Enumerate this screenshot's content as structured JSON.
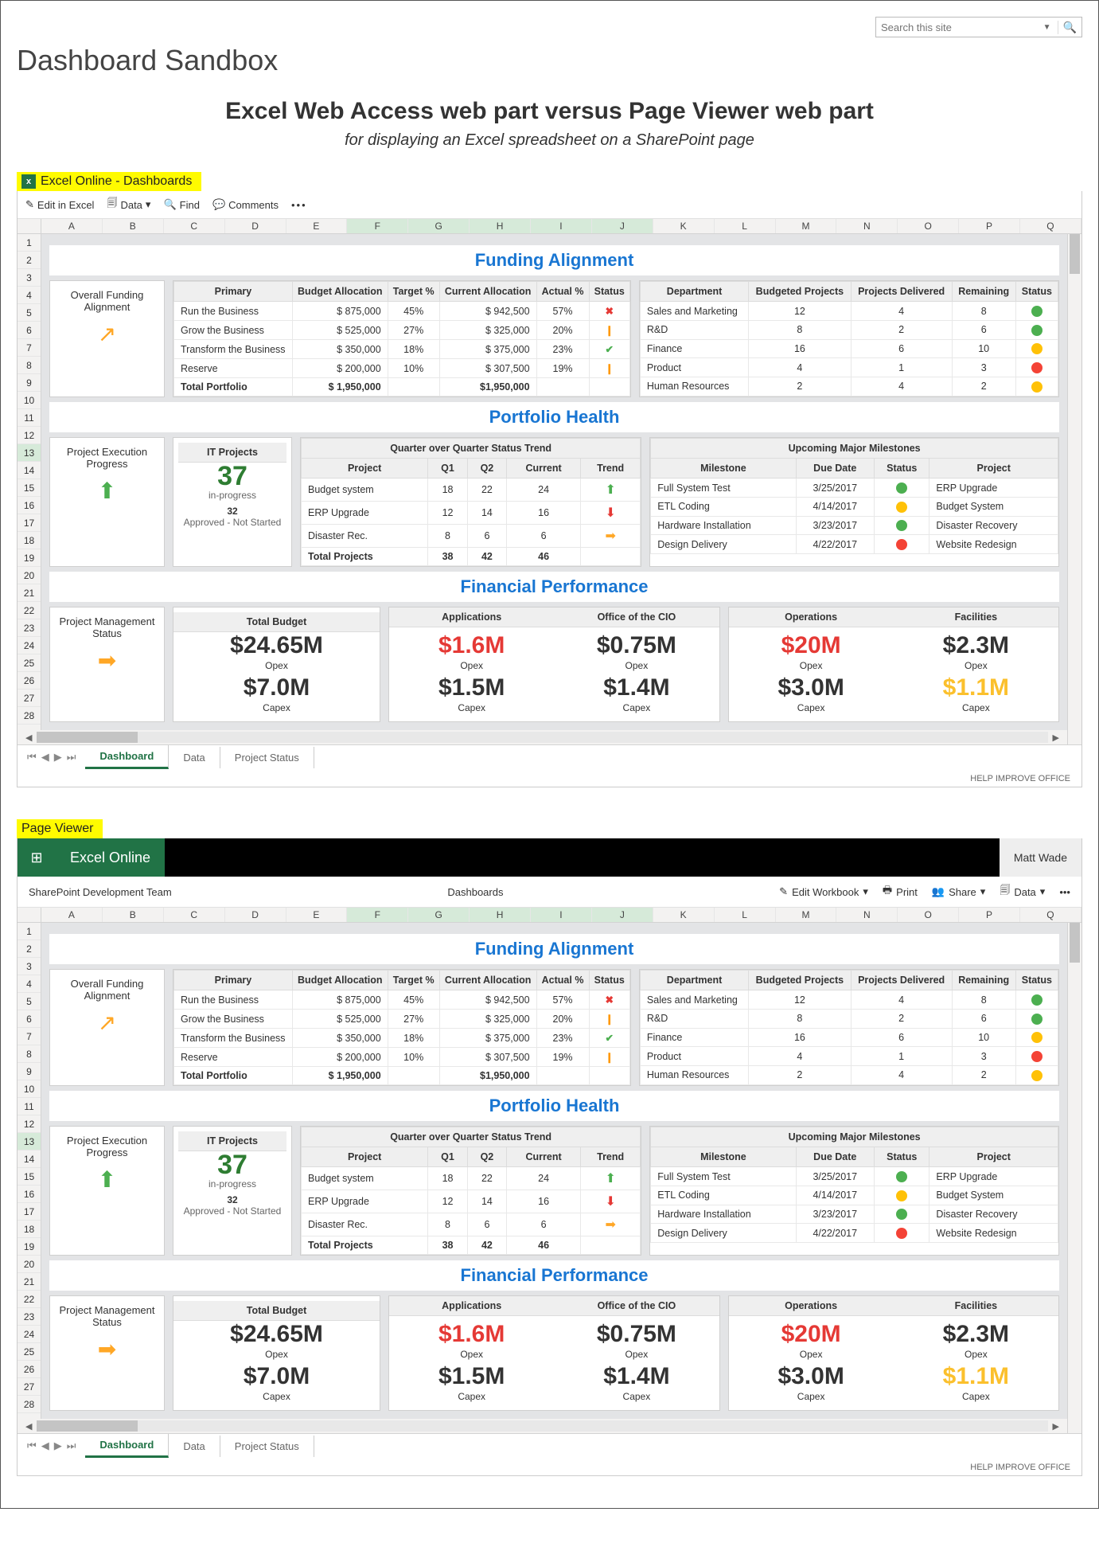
{
  "site": {
    "title": "Dashboard Sandbox",
    "search_placeholder": "Search this site"
  },
  "article": {
    "title": "Excel Web Access web part versus Page Viewer web part",
    "subtitle": "for displaying an Excel spreadsheet on a SharePoint page"
  },
  "labels": {
    "ewa": "Excel Online - Dashboards",
    "pv": "Page Viewer"
  },
  "ewa_toolbar": {
    "edit": "Edit in Excel",
    "data": "Data",
    "find": "Find",
    "comments": "Comments"
  },
  "pv_header": {
    "brand": "Excel Online",
    "user": "Matt Wade"
  },
  "pv_sub": {
    "left": "SharePoint Development Team",
    "center": "Dashboards",
    "edit": "Edit Workbook",
    "print": "Print",
    "share": "Share",
    "data": "Data"
  },
  "columns": [
    "A",
    "B",
    "C",
    "D",
    "E",
    "F",
    "G",
    "H",
    "I",
    "J",
    "K",
    "L",
    "M",
    "N",
    "O",
    "P",
    "Q"
  ],
  "rows1": [
    "1",
    "2",
    "3",
    "4",
    "5",
    "6",
    "7",
    "8",
    "9",
    "10",
    "11",
    "12",
    "13",
    "14",
    "15",
    "16",
    "17",
    "18",
    "19",
    "20",
    "21",
    "22",
    "23",
    "24",
    "25",
    "26",
    "27",
    "28"
  ],
  "sections": {
    "fund": "Funding Alignment",
    "port": "Portfolio Health",
    "fin": "Financial Performance"
  },
  "overall": {
    "title": "Overall Funding Alignment"
  },
  "primary": {
    "headers": [
      "Primary",
      "Budget Allocation",
      "Target %",
      "Current Allocation",
      "Actual %",
      "Status"
    ],
    "rows": [
      {
        "p": "Run the Business",
        "b": "$       875,000",
        "t": "45%",
        "c": "$    942,500",
        "a": "57%",
        "s": "x"
      },
      {
        "p": "Grow the Business",
        "b": "$       525,000",
        "t": "27%",
        "c": "$    325,000",
        "a": "20%",
        "s": "!"
      },
      {
        "p": "Transform the Business",
        "b": "$       350,000",
        "t": "18%",
        "c": "$    375,000",
        "a": "23%",
        "s": "ok"
      },
      {
        "p": "Reserve",
        "b": "$       200,000",
        "t": "10%",
        "c": "$    307,500",
        "a": "19%",
        "s": "!"
      }
    ],
    "total": {
      "p": "Total Portfolio",
      "b": "$   1,950,000",
      "c": "$1,950,000"
    }
  },
  "dept": {
    "headers": [
      "Department",
      "Budgeted Projects",
      "Projects Delivered",
      "Remaining",
      "Status"
    ],
    "rows": [
      {
        "d": "Sales and Marketing",
        "b": "12",
        "p": "4",
        "r": "8",
        "s": "g"
      },
      {
        "d": "R&D",
        "b": "8",
        "p": "2",
        "r": "6",
        "s": "g"
      },
      {
        "d": "Finance",
        "b": "16",
        "p": "6",
        "r": "10",
        "s": "y"
      },
      {
        "d": "Product",
        "b": "4",
        "p": "1",
        "r": "3",
        "s": "r"
      },
      {
        "d": "Human Resources",
        "b": "2",
        "p": "4",
        "r": "2",
        "s": "y"
      }
    ]
  },
  "pep": {
    "title": "Project Execution Progress"
  },
  "it": {
    "title": "IT Projects",
    "big": "37",
    "sub1": "in-progress",
    "n2": "32",
    "sub2": "Approved - Not Started"
  },
  "qoq": {
    "title": "Quarter over Quarter Status Trend",
    "headers": [
      "Project",
      "Q1",
      "Q2",
      "Current",
      "Trend"
    ],
    "rows": [
      {
        "p": "Budget system",
        "q1": "18",
        "q2": "22",
        "c": "24",
        "t": "up"
      },
      {
        "p": "ERP Upgrade",
        "q1": "12",
        "q2": "14",
        "c": "16",
        "t": "down"
      },
      {
        "p": "Disaster Rec.",
        "q1": "8",
        "q2": "6",
        "c": "6",
        "t": "rt"
      }
    ],
    "total": {
      "p": "Total Projects",
      "q1": "38",
      "q2": "42",
      "c": "46"
    }
  },
  "mile": {
    "title": "Upcoming Major Milestones",
    "headers": [
      "Milestone",
      "Due Date",
      "Status",
      "Project"
    ],
    "rows": [
      {
        "m": "Full System Test",
        "d": "3/25/2017",
        "s": "g",
        "p": "ERP Upgrade"
      },
      {
        "m": "ETL Coding",
        "d": "4/14/2017",
        "s": "y",
        "p": "Budget System"
      },
      {
        "m": "Hardware Installation",
        "d": "3/23/2017",
        "s": "g",
        "p": "Disaster Recovery"
      },
      {
        "m": "Design Delivery",
        "d": "4/22/2017",
        "s": "r",
        "p": "Website Redesign"
      }
    ]
  },
  "pms": {
    "title": "Project Management Status"
  },
  "fin": {
    "tb": {
      "h": "Total Budget",
      "v1": "$24.65M",
      "s1": "Opex",
      "v2": "$7.0M",
      "s2": "Capex"
    },
    "app": {
      "h": "Applications",
      "v1": "$1.6M",
      "s1": "Opex",
      "v2": "$1.5M",
      "s2": "Capex",
      "c1": "red"
    },
    "cio": {
      "h": "Office of the CIO",
      "v1": "$0.75M",
      "s1": "Opex",
      "v2": "$1.4M",
      "s2": "Capex"
    },
    "ops": {
      "h": "Operations",
      "v1": "$20M",
      "s1": "Opex",
      "v2": "$3.0M",
      "s2": "Capex",
      "c1": "red"
    },
    "fac": {
      "h": "Facilities",
      "v1": "$2.3M",
      "s1": "Opex",
      "v2": "$1.1M",
      "s2": "Capex",
      "c2": "yy"
    }
  },
  "tabs": [
    "Dashboard",
    "Data",
    "Project Status"
  ],
  "status": "HELP IMPROVE OFFICE"
}
